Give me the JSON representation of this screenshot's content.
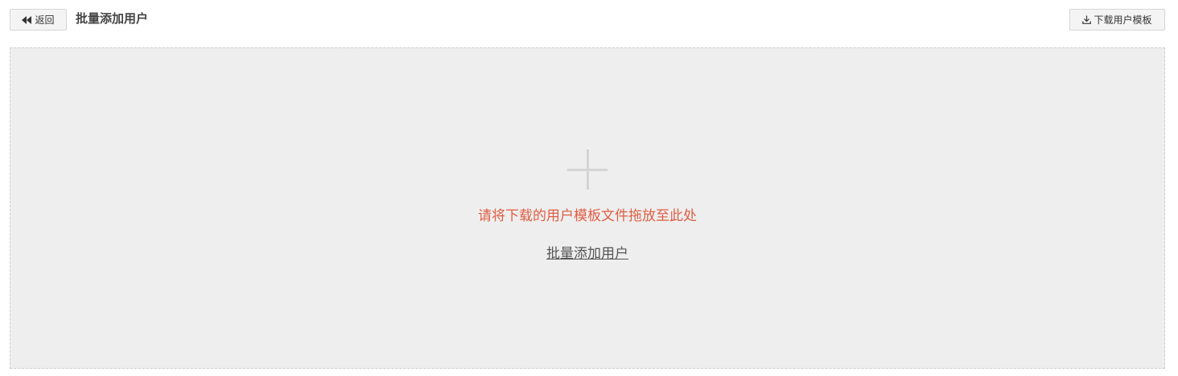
{
  "header": {
    "back_label": "返回",
    "back_icon": "rewind-icon",
    "title": "批量添加用户",
    "download_label": "下载用户模板",
    "download_icon": "download-icon"
  },
  "dropzone": {
    "icon": "plus-icon",
    "hint": "请将下载的用户模板文件拖放至此处",
    "upload_link_label": "批量添加用户"
  },
  "colors": {
    "hint": "#e05d43",
    "dropzone_bg": "#eeeeee"
  }
}
